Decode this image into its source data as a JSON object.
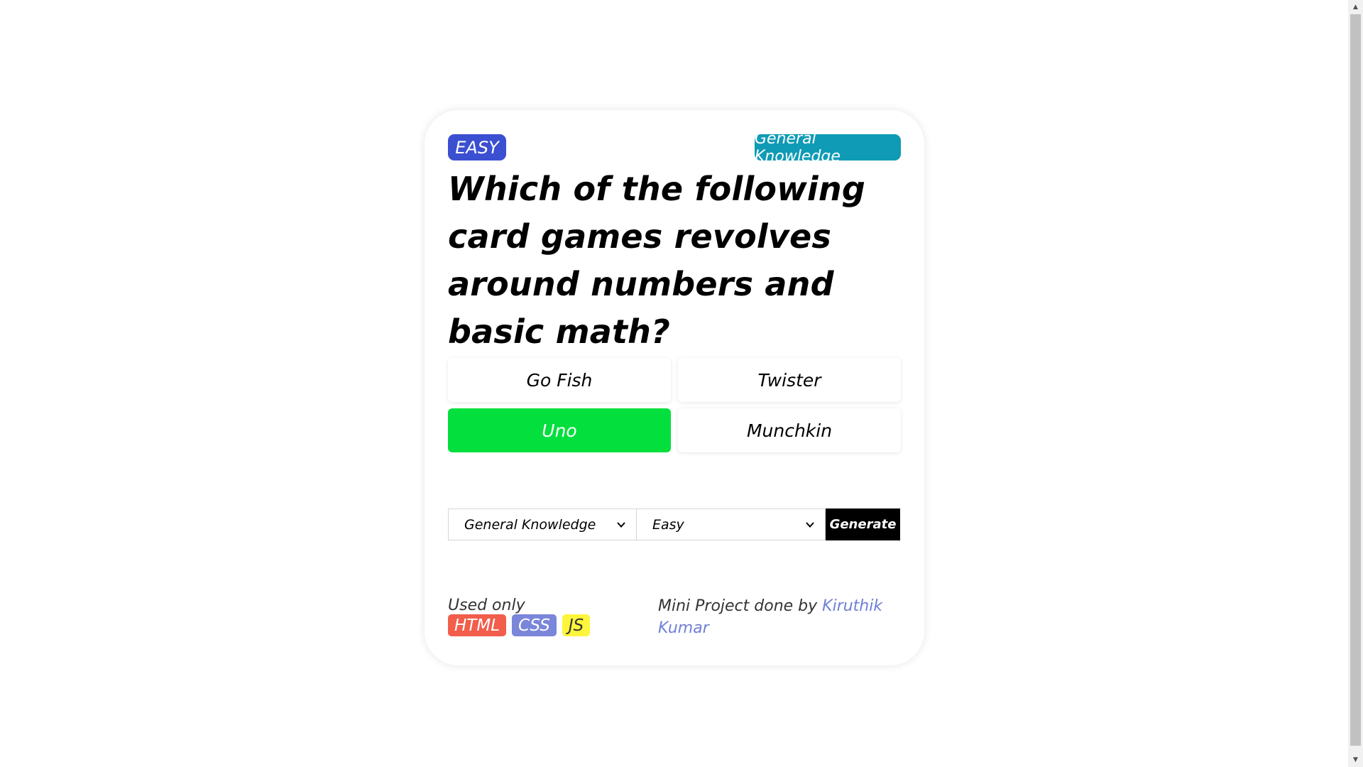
{
  "quiz": {
    "difficulty_badge": "EASY",
    "category_badge": "General Knowledge",
    "question": "Which of the following card games revolves around numbers and basic math?",
    "answers": [
      {
        "label": "Go Fish",
        "state": "default"
      },
      {
        "label": "Twister",
        "state": "default"
      },
      {
        "label": "Uno",
        "state": "correct"
      },
      {
        "label": "Munchkin",
        "state": "default"
      }
    ]
  },
  "controls": {
    "category_select": {
      "selected": "General Knowledge"
    },
    "difficulty_select": {
      "selected": "Easy"
    },
    "generate_label": "Generate"
  },
  "footer": {
    "used_text": "Used only",
    "tech": [
      "HTML",
      "CSS",
      "JS"
    ],
    "credit_text": "Mini Project done by ",
    "author": "Kiruthik Kumar"
  },
  "colors": {
    "difficulty_badge": "#3b4fd1",
    "category_badge": "#0f9bb5",
    "correct_answer": "#03df3c",
    "html_tag": "#f25d4c",
    "css_tag": "#7a86d9",
    "js_tag": "#fdf53c",
    "author_link": "#6f7fd6"
  }
}
